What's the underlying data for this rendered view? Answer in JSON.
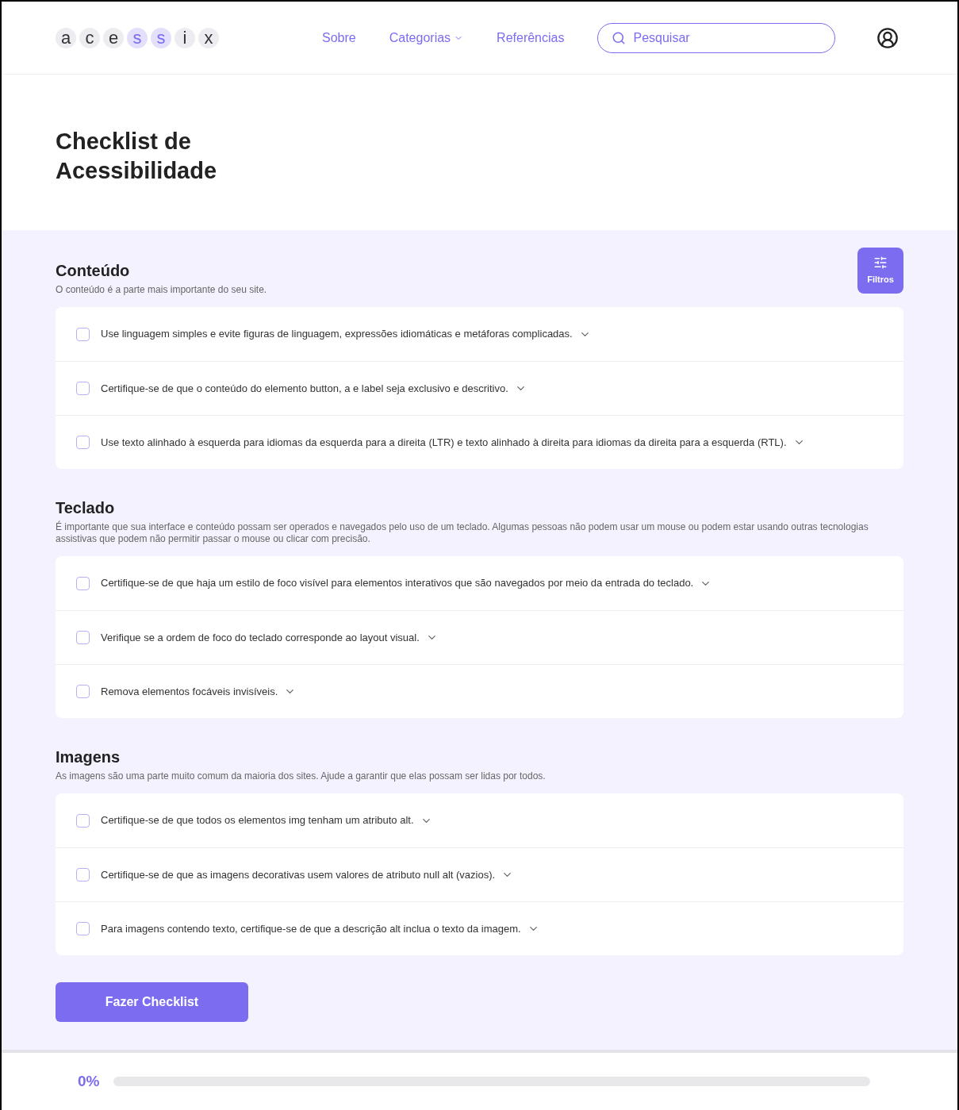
{
  "logo": [
    {
      "letter": "a",
      "highlighted": false
    },
    {
      "letter": "c",
      "highlighted": false
    },
    {
      "letter": "e",
      "highlighted": false
    },
    {
      "letter": "s",
      "highlighted": true
    },
    {
      "letter": "s",
      "highlighted": true
    },
    {
      "letter": "i",
      "highlighted": false
    },
    {
      "letter": "x",
      "highlighted": false
    }
  ],
  "nav": [
    {
      "label": "Sobre",
      "dropdown": false
    },
    {
      "label": "Categorias",
      "dropdown": true
    },
    {
      "label": "Referências",
      "dropdown": false
    }
  ],
  "search": {
    "placeholder": "Pesquisar"
  },
  "page_title": "Checklist de Acessibilidade",
  "filter_button": "Filtros",
  "sections": [
    {
      "title": "Conteúdo",
      "description": "O conteúdo é a parte mais importante do seu site.",
      "items": [
        {
          "text": "Use linguagem simples e evite figuras de linguagem, expressões idiomáticas e metáforas complicadas.",
          "checked": false
        },
        {
          "text": "Certifique-se de que o conteúdo do elemento button, a e label seja exclusivo e descritivo.",
          "checked": false
        },
        {
          "text": "Use texto alinhado à esquerda para idiomas da esquerda para a direita (LTR) e texto alinhado à direita para idiomas da direita para a esquerda (RTL).",
          "checked": false
        }
      ]
    },
    {
      "title": "Teclado",
      "description": "É importante que sua interface e conteúdo possam ser operados e navegados pelo uso de um teclado. Algumas pessoas não podem usar um mouse ou podem estar usando outras tecnologias assistivas que podem não permitir passar o mouse ou clicar com precisão.",
      "items": [
        {
          "text": "Certifique-se de que haja um estilo de foco visível para elementos interativos que são navegados por meio da entrada do teclado.",
          "checked": false
        },
        {
          "text": "Verifique se a ordem de foco do teclado corresponde ao layout visual.",
          "checked": false
        },
        {
          "text": "Remova elementos focáveis invisíveis.",
          "checked": false
        }
      ]
    },
    {
      "title": "Imagens",
      "description": "As imagens são uma parte muito comum da maioria dos sites. Ajude a garantir que elas possam ser lidas por todos.",
      "items": [
        {
          "text": "Certifique-se de que todos os elementos img tenham um atributo alt.",
          "checked": false
        },
        {
          "text": "Certifique-se de que as imagens decorativas usem valores de atributo null alt (vazios).",
          "checked": false
        },
        {
          "text": "Para imagens contendo texto, certifique-se de que a descrição alt inclua o texto da imagem.",
          "checked": false
        }
      ]
    }
  ],
  "submit_button": "Fazer Checklist",
  "progress": {
    "reading": "0%",
    "level": 0
  }
}
